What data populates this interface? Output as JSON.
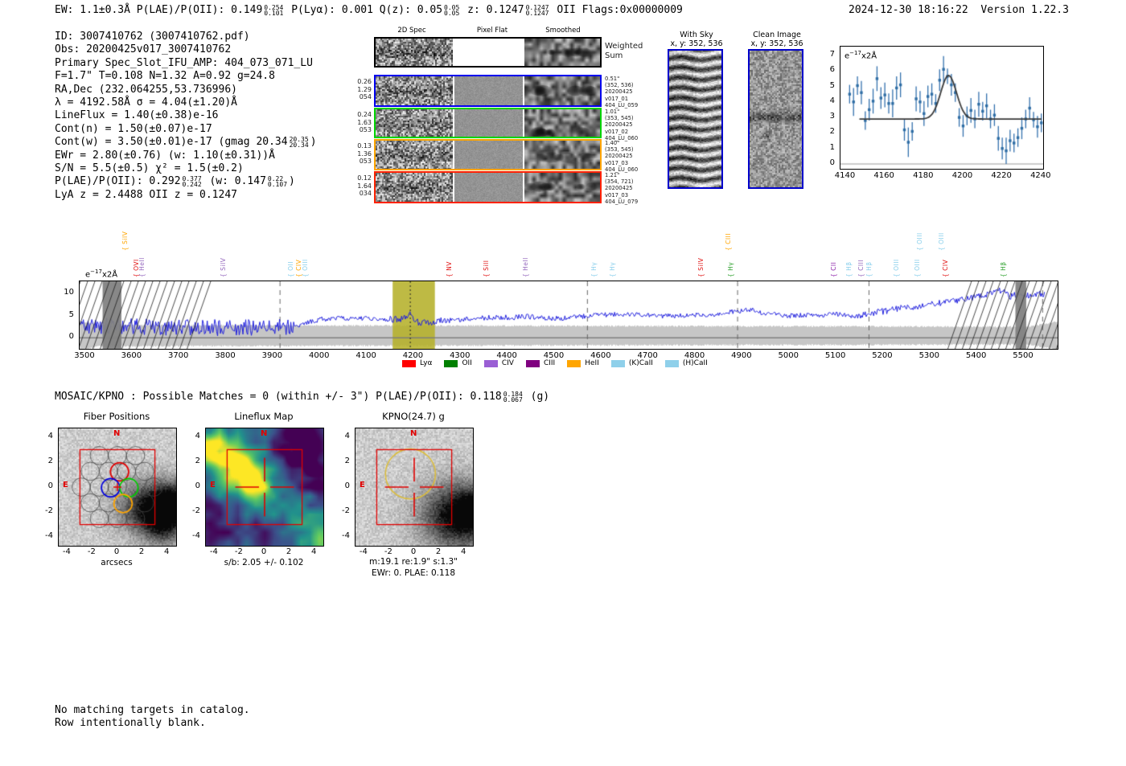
{
  "header": {
    "left_parts": [
      {
        "t": "EW: 1.1±0.3Å  P(LAE)/P(OII): 0.149"
      },
      {
        "frac": [
          "0.254",
          "0.101"
        ]
      },
      {
        "t": "  P(Lyα): 0.001  Q(z): 0.05"
      },
      {
        "frac": [
          "0.05",
          "0.05"
        ]
      },
      {
        "t": "  z: 0.1247"
      },
      {
        "frac": [
          "0.1247",
          "0.1247"
        ]
      },
      {
        "t": " OII  Flags:0x00000009"
      }
    ],
    "datetime": "2024-12-30 18:16:22",
    "version": "Version 1.22.3"
  },
  "info_lines": [
    {
      "parts": [
        {
          "t": "ID: 3007410762 (3007410762.pdf)"
        }
      ]
    },
    {
      "parts": [
        {
          "t": "Obs: 20200425v017_3007410762"
        }
      ]
    },
    {
      "parts": [
        {
          "t": "Primary Spec_Slot_IFU_AMP: 404_073_071_LU"
        }
      ]
    },
    {
      "parts": [
        {
          "t": "F=1.7\"  T=0.108  N=1.32  A=0.92  g=24.8"
        }
      ]
    },
    {
      "parts": [
        {
          "t": "RA,Dec (232.064255,53.736996)"
        }
      ]
    },
    {
      "parts": [
        {
          "t": "λ = 4192.58Å  σ = 4.04(±1.20)Å"
        }
      ]
    },
    {
      "parts": [
        {
          "t": "LineFlux = 1.40(±0.38)e-16"
        }
      ]
    },
    {
      "parts": [
        {
          "t": "Cont(n) = 1.50(±0.07)e-17"
        }
      ]
    },
    {
      "parts": [
        {
          "t": "Cont(w) = 3.50(±0.01)e-17 (gmag 20.34"
        },
        {
          "frac": [
            "20.35",
            "20.34"
          ]
        },
        {
          "t": ")"
        }
      ]
    },
    {
      "parts": [
        {
          "t": "EWr = 2.80(±0.76) (w: 1.10(±0.31))Å"
        }
      ]
    },
    {
      "parts": [
        {
          "t": "S/N = 5.5(±0.5)  χ² = 1.5(±0.2)"
        }
      ]
    },
    {
      "parts": [
        {
          "t": "P(LAE)/P(OII): 0.292"
        },
        {
          "frac": [
            "0.377",
            "0.242"
          ]
        },
        {
          "t": " (w: 0.147"
        },
        {
          "frac": [
            "0.22",
            "0.107"
          ]
        },
        {
          "t": ")"
        }
      ]
    },
    {
      "parts": [
        {
          "t": "LyA z = 2.4488  OII z = 0.1247"
        }
      ]
    }
  ],
  "spec2d": {
    "col_titles": [
      "2D Spec",
      "Pixel Flat",
      "Smoothed"
    ],
    "rows": [
      {
        "border": "#000000",
        "left_lines": [],
        "right_lines": [
          "Weighted",
          "Sum"
        ],
        "kind": "ws"
      },
      {
        "border": "#0000ee",
        "left_lines": [
          "0.26",
          "1.29",
          "054"
        ],
        "right_lines": [
          "0.51\"",
          "(352, 536)",
          "20200425",
          "v017_01",
          "404_LU_059"
        ],
        "kind": "det"
      },
      {
        "border": "#00d400",
        "left_lines": [
          "0.24",
          "1.63",
          "053"
        ],
        "right_lines": [
          "1.01\"",
          "(353, 545)",
          "20200425",
          "v017_02",
          "404_LU_060"
        ],
        "kind": "det"
      },
      {
        "border": "#ffa500",
        "left_lines": [
          "0.13",
          "1.36",
          "053"
        ],
        "right_lines": [
          "1.40\"",
          "(353, 545)",
          "20200425",
          "v017_03",
          "404_LU_060"
        ],
        "kind": "det"
      },
      {
        "border": "#ff2200",
        "left_lines": [
          "0.12",
          "1.64",
          "034"
        ],
        "right_lines": [
          "1.21\"",
          "(354, 721)",
          "20200425",
          "v017_03",
          "404_LU_079"
        ],
        "kind": "det"
      }
    ]
  },
  "cutouts": {
    "with_sky": {
      "title": "With Sky",
      "subtitle": "x, y: 352, 536"
    },
    "clean": {
      "title": "Clean Image",
      "subtitle": "x, y: 352, 536"
    }
  },
  "mosaic_line_parts": [
    {
      "t": "MOSAIC/KPNO : Possible Matches = 0 (within +/- 3\")  P(LAE)/P(OII): 0.118"
    },
    {
      "frac": [
        "0.184",
        "0.067"
      ]
    },
    {
      "t": " (g)"
    }
  ],
  "footer_lines": [
    "No matching targets in catalog.",
    "Row intentionally blank."
  ],
  "chart_data": [
    {
      "id": "line_fit_zoom",
      "type": "scatter",
      "annotation": {
        "prefix": "e",
        "sup": "−17",
        "suffix": "x2Å"
      },
      "x_ticks": [
        4140,
        4160,
        4180,
        4200,
        4220,
        4240
      ],
      "y_ticks": [
        0,
        1,
        2,
        3,
        4,
        5,
        6,
        7
      ],
      "x_range": [
        4138,
        4243
      ],
      "y_range": [
        -0.3,
        7.4
      ],
      "point_color": "#2e6da4",
      "fit_color": "#3a3a3a",
      "fit": {
        "center": 4192.58,
        "sigma": 4.04,
        "baseline": 2.9,
        "peak": 5.7
      },
      "points": [
        [
          4142,
          4.5,
          0.6
        ],
        [
          4144,
          4.0,
          0.9
        ],
        [
          4146,
          5.05,
          0.6
        ],
        [
          4148,
          4.6,
          0.75
        ],
        [
          4150,
          2.8,
          0.6
        ],
        [
          4152,
          3.5,
          0.7
        ],
        [
          4154,
          4.05,
          0.8
        ],
        [
          4156,
          5.5,
          0.8
        ],
        [
          4158,
          4.25,
          0.7
        ],
        [
          4160,
          4.45,
          0.8
        ],
        [
          4162,
          3.9,
          0.65
        ],
        [
          4164,
          3.9,
          0.9
        ],
        [
          4166,
          4.9,
          0.75
        ],
        [
          4168,
          5.1,
          0.8
        ],
        [
          4170,
          2.2,
          0.7
        ],
        [
          4172,
          1.4,
          0.95
        ],
        [
          4174,
          2.1,
          0.6
        ],
        [
          4176,
          4.2,
          0.8
        ],
        [
          4178,
          4.0,
          0.7
        ],
        [
          4180,
          3.25,
          0.8
        ],
        [
          4182,
          4.35,
          0.7
        ],
        [
          4184,
          4.5,
          0.7
        ],
        [
          4186,
          3.9,
          0.6
        ],
        [
          4188,
          5.4,
          0.7
        ],
        [
          4190,
          6.1,
          0.85
        ],
        [
          4192,
          5.65,
          0.5
        ],
        [
          4194,
          5.1,
          0.7
        ],
        [
          4196,
          4.6,
          0.6
        ],
        [
          4198,
          3.0,
          0.6
        ],
        [
          4200,
          2.45,
          0.7
        ],
        [
          4202,
          3.1,
          0.6
        ],
        [
          4204,
          3.45,
          0.8
        ],
        [
          4206,
          2.9,
          0.6
        ],
        [
          4208,
          3.85,
          0.8
        ],
        [
          4210,
          3.4,
          0.6
        ],
        [
          4212,
          3.75,
          0.8
        ],
        [
          4214,
          2.9,
          0.6
        ],
        [
          4216,
          3.15,
          0.7
        ],
        [
          4218,
          1.65,
          0.8
        ],
        [
          4220,
          1.0,
          0.7
        ],
        [
          4222,
          0.85,
          0.85
        ],
        [
          4224,
          1.5,
          0.7
        ],
        [
          4226,
          1.35,
          0.6
        ],
        [
          4228,
          1.7,
          0.6
        ],
        [
          4230,
          2.3,
          0.7
        ],
        [
          4232,
          2.9,
          0.6
        ],
        [
          4234,
          3.6,
          0.7
        ],
        [
          4236,
          2.85,
          0.5
        ],
        [
          4238,
          2.4,
          0.7
        ],
        [
          4240,
          2.65,
          0.6
        ]
      ]
    },
    {
      "id": "full_spectrum",
      "type": "line",
      "annotation": {
        "prefix": "e",
        "sup": "−17",
        "suffix": "x2Å"
      },
      "x_ticks": [
        3500,
        3600,
        3700,
        3800,
        3900,
        4000,
        4100,
        4200,
        4300,
        4400,
        4500,
        4600,
        4700,
        4800,
        4900,
        5000,
        5100,
        5200,
        5300,
        5400,
        5500
      ],
      "y_ticks": [
        0,
        5,
        10
      ],
      "x_range": [
        3488,
        5572
      ],
      "y_range": [
        -2.5,
        12.8
      ],
      "spectrum_color": "#2020dd",
      "highlight_band": {
        "from": 4155,
        "to": 4245,
        "color": "#b5b02a",
        "dotted_line": 4192.58
      },
      "hatch_bands": [
        [
          3537,
          3577
        ],
        [
          5482,
          5505
        ]
      ],
      "dashed_lines": [
        3915,
        4570,
        4890,
        5170,
        5540
      ],
      "emission": {
        "center": 4192.58,
        "sigma": 4.04,
        "amp": 1.6
      },
      "error_band": {
        "center": 0.5,
        "halfwidth_left": 2.4,
        "halfwidth_right": 2.0,
        "color": "#c6c6c6"
      },
      "continuum_anchors": [
        [
          3490,
          2.9
        ],
        [
          3550,
          2.6
        ],
        [
          3600,
          2.5
        ],
        [
          3700,
          2.4
        ],
        [
          3800,
          2.3
        ],
        [
          3900,
          2.2
        ],
        [
          3950,
          2.7
        ],
        [
          4000,
          4.2
        ],
        [
          4050,
          4.5
        ],
        [
          4100,
          4.4
        ],
        [
          4150,
          4.2
        ],
        [
          4185,
          4.4
        ],
        [
          4200,
          4.0
        ],
        [
          4215,
          3.3
        ],
        [
          4235,
          3.6
        ],
        [
          4300,
          4.2
        ],
        [
          4350,
          4.5
        ],
        [
          4400,
          4.6
        ],
        [
          4450,
          4.8
        ],
        [
          4500,
          4.4
        ],
        [
          4550,
          4.7
        ],
        [
          4600,
          5.2
        ],
        [
          4650,
          5.3
        ],
        [
          4700,
          5.0
        ],
        [
          4750,
          4.9
        ],
        [
          4800,
          5.1
        ],
        [
          4850,
          5.4
        ],
        [
          4880,
          6.0
        ],
        [
          4920,
          6.3
        ],
        [
          4950,
          5.4
        ],
        [
          5000,
          5.0
        ],
        [
          5050,
          5.1
        ],
        [
          5100,
          5.3
        ],
        [
          5150,
          4.9
        ],
        [
          5200,
          6.0
        ],
        [
          5250,
          6.9
        ],
        [
          5300,
          7.5
        ],
        [
          5350,
          8.4
        ],
        [
          5400,
          9.2
        ],
        [
          5430,
          10.3
        ],
        [
          5455,
          10.8
        ],
        [
          5470,
          9.2
        ],
        [
          5490,
          10.2
        ],
        [
          5510,
          9.6
        ],
        [
          5545,
          9.9
        ]
      ],
      "noise_segments": [
        {
          "from": 3488,
          "to": 3945,
          "amp": 1.9
        },
        {
          "from": 3945,
          "to": 4150,
          "amp": 0.55
        },
        {
          "from": 4150,
          "to": 4260,
          "amp": 0.8
        },
        {
          "from": 4260,
          "to": 4600,
          "amp": 0.6
        },
        {
          "from": 4600,
          "to": 5150,
          "amp": 0.55
        },
        {
          "from": 5150,
          "to": 5572,
          "amp": 0.75
        }
      ],
      "line_labels": [
        {
          "text": "SiIV",
          "wave": 3582,
          "color": "#ffa500",
          "row": 1
        },
        {
          "text": "OVI",
          "wave": 3606,
          "color": "#e01010",
          "row": 0
        },
        {
          "text": "HeII",
          "wave": 3619,
          "color": "#9467bd",
          "row": 0
        },
        {
          "text": "SiIV",
          "wave": 3792,
          "color": "#9467bd",
          "row": 0
        },
        {
          "text": "OII",
          "wave": 3935,
          "color": "#87ceeb",
          "row": 0
        },
        {
          "text": "CIV",
          "wave": 3952,
          "color": "#ffa500",
          "row": 0
        },
        {
          "text": "OIII",
          "wave": 3967,
          "color": "#87ceeb",
          "row": 0
        },
        {
          "text": "NV",
          "wave": 4273,
          "color": "#e01010",
          "row": 0
        },
        {
          "text": "SiII",
          "wave": 4352,
          "color": "#e01010",
          "row": 0
        },
        {
          "text": "HeII",
          "wave": 4436,
          "color": "#9467bd",
          "row": 0
        },
        {
          "text": "Hγ",
          "wave": 4582,
          "color": "#87ceeb",
          "row": 0
        },
        {
          "text": "Hγ",
          "wave": 4621,
          "color": "#87ceeb",
          "row": 0
        },
        {
          "text": "SiIV",
          "wave": 4809,
          "color": "#e01010",
          "row": 0
        },
        {
          "text": "CIII",
          "wave": 4868,
          "color": "#ffa500",
          "row": 1
        },
        {
          "text": "Hγ",
          "wave": 4872,
          "color": "#2ca02c",
          "row": 0
        },
        {
          "text": "CII",
          "wave": 5092,
          "color": "#8e24aa",
          "row": 0
        },
        {
          "text": "Hβ",
          "wave": 5125,
          "color": "#87ceeb",
          "row": 0
        },
        {
          "text": "CIII",
          "wave": 5150,
          "color": "#9467bd",
          "row": 0
        },
        {
          "text": "Hβ",
          "wave": 5167,
          "color": "#87ceeb",
          "row": 0
        },
        {
          "text": "OIII",
          "wave": 5226,
          "color": "#87ceeb",
          "row": 0
        },
        {
          "text": "OIII",
          "wave": 5271,
          "color": "#87ceeb",
          "row": 0
        },
        {
          "text": "OIII",
          "wave": 5276,
          "color": "#87ceeb",
          "row": 1
        },
        {
          "text": "OIII",
          "wave": 5322,
          "color": "#87ceeb",
          "row": 1
        },
        {
          "text": "CIV",
          "wave": 5330,
          "color": "#e01010",
          "row": 0
        },
        {
          "text": "Hβ",
          "wave": 5453,
          "color": "#2ca02c",
          "row": 0
        }
      ],
      "legend": [
        {
          "label": "Lyα",
          "color": "#ff0000"
        },
        {
          "label": "OII",
          "color": "#008000"
        },
        {
          "label": "CIV",
          "color": "#9a5fd4"
        },
        {
          "label": "CIII",
          "color": "#800080"
        },
        {
          "label": "HeII",
          "color": "#ffa500"
        },
        {
          "label": "(K)CaII",
          "color": "#8fd0ea"
        },
        {
          "label": "(H)CaII",
          "color": "#8fd0ea"
        }
      ]
    },
    {
      "id": "fiber_positions",
      "type": "image",
      "title": "Fiber Positions",
      "xlabel": "arcsecs",
      "x_ticks": [
        -4,
        -2,
        0,
        2,
        4
      ],
      "y_ticks": [
        4,
        2,
        0,
        -2,
        -4
      ],
      "range": [
        -4.7,
        4.7
      ],
      "compass": {
        "north": "N",
        "east": "E",
        "color": "#e00000"
      },
      "ifu_box_half": 3,
      "fiber_radius": 0.73,
      "highlight_fibers": [
        {
          "x": 0.17,
          "y": 1.22,
          "color": "#e00000"
        },
        {
          "x": -0.55,
          "y": -0.05,
          "color": "#0000dd"
        },
        {
          "x": 0.92,
          "y": -0.05,
          "color": "#00cc00"
        },
        {
          "x": 0.45,
          "y": -1.32,
          "color": "#ffa500"
        }
      ]
    },
    {
      "id": "lineflux_map",
      "type": "heatmap",
      "title": "Lineflux Map",
      "xlabel": "s/b: 2.05 +/- 0.102",
      "x_ticks": [
        -4,
        -2,
        0,
        2,
        4
      ],
      "y_ticks": [
        4,
        2,
        0,
        -2,
        -4
      ],
      "range": [
        -4.7,
        4.7
      ],
      "colormap": "viridis",
      "compass": {
        "north": "N",
        "east": "E",
        "color": "#e00000"
      }
    },
    {
      "id": "kpno_g",
      "type": "image",
      "title": "KPNO(24.7) g",
      "xlabel_line1": "m:19.1 re:1.9\" s:1.3\"",
      "xlabel_line2": "EWr: 0. PLAE: 0.118",
      "x_ticks": [
        -4,
        -2,
        0,
        2,
        4
      ],
      "y_ticks": [
        4,
        2,
        0,
        -2,
        -4
      ],
      "range": [
        -4.7,
        4.7
      ],
      "compass": {
        "north": "N",
        "east": "E",
        "color": "#e00000"
      },
      "aperture": {
        "x": -0.3,
        "y": 1.05,
        "r": 2.0,
        "color": "#dcbe3e"
      }
    }
  ]
}
